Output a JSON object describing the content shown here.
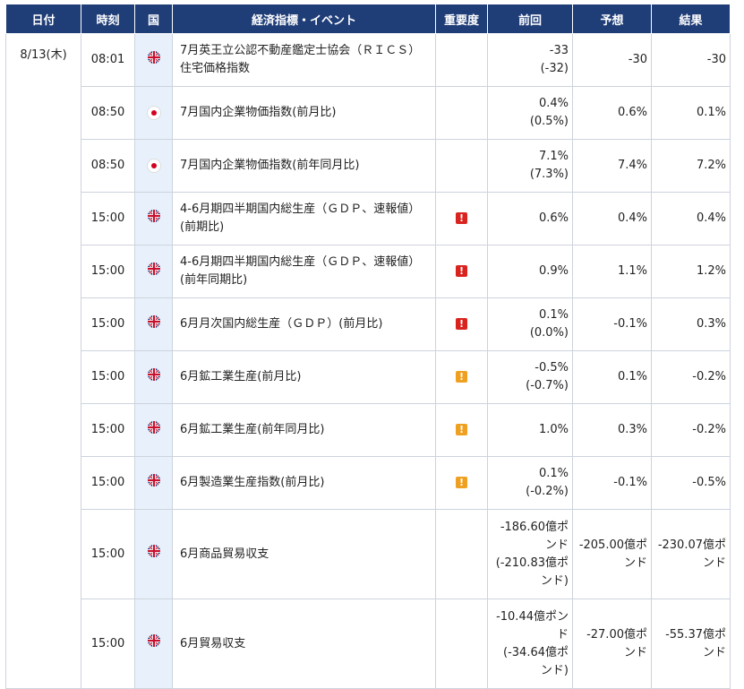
{
  "headers": {
    "date": "日付",
    "time": "時刻",
    "country": "国",
    "event": "経済指標・イベント",
    "importance": "重要度",
    "previous": "前回",
    "forecast": "予想",
    "result": "結果"
  },
  "date": "8/13(木)",
  "rows": [
    {
      "time": "08:01",
      "flag": "uk-flag-icon",
      "event": "7月英王立公認不動産鑑定士協会（ＲＩＣＳ）住宅価格指数",
      "importance": "",
      "previous": "-33",
      "previous_revised": "(-32)",
      "forecast": "-30",
      "result": "-30"
    },
    {
      "time": "08:50",
      "flag": "japan-flag-icon",
      "event": "7月国内企業物価指数(前月比)",
      "importance": "",
      "previous": "0.4%",
      "previous_revised": "(0.5%)",
      "forecast": "0.6%",
      "result": "0.1%"
    },
    {
      "time": "08:50",
      "flag": "japan-flag-icon",
      "event": "7月国内企業物価指数(前年同月比)",
      "importance": "",
      "previous": "7.1%",
      "previous_revised": "(7.3%)",
      "forecast": "7.4%",
      "result": "7.2%"
    },
    {
      "time": "15:00",
      "flag": "uk-flag-icon",
      "event": "4-6月期四半期国内総生産（ＧＤＰ、速報値）(前期比)",
      "importance": "high",
      "previous": "0.6%",
      "previous_revised": "",
      "forecast": "0.4%",
      "result": "0.4%"
    },
    {
      "time": "15:00",
      "flag": "uk-flag-icon",
      "event": "4-6月期四半期国内総生産（ＧＤＰ、速報値）(前年同期比)",
      "importance": "high",
      "previous": "0.9%",
      "previous_revised": "",
      "forecast": "1.1%",
      "result": "1.2%"
    },
    {
      "time": "15:00",
      "flag": "uk-flag-icon",
      "event": "6月月次国内総生産（ＧＤＰ）(前月比)",
      "importance": "high",
      "previous": "0.1%",
      "previous_revised": "(0.0%)",
      "forecast": "-0.1%",
      "result": "0.3%"
    },
    {
      "time": "15:00",
      "flag": "uk-flag-icon",
      "event": "6月鉱工業生産(前月比)",
      "importance": "medium",
      "previous": "-0.5%",
      "previous_revised": "(-0.7%)",
      "forecast": "0.1%",
      "result": "-0.2%"
    },
    {
      "time": "15:00",
      "flag": "uk-flag-icon",
      "event": "6月鉱工業生産(前年同月比)",
      "importance": "medium",
      "previous": "1.0%",
      "previous_revised": "",
      "forecast": "0.3%",
      "result": "-0.2%"
    },
    {
      "time": "15:00",
      "flag": "uk-flag-icon",
      "event": "6月製造業生産指数(前月比)",
      "importance": "medium",
      "previous": "0.1%",
      "previous_revised": "(-0.2%)",
      "forecast": "-0.1%",
      "result": "-0.5%"
    },
    {
      "time": "15:00",
      "flag": "uk-flag-icon",
      "event": "6月商品貿易収支",
      "importance": "",
      "previous": "-186.60億ポンド",
      "previous_revised": "(-210.83億ポンド)",
      "forecast": "-205.00億ポンド",
      "result": "-230.07億ポンド"
    },
    {
      "time": "15:00",
      "flag": "uk-flag-icon",
      "event": "6月貿易収支",
      "importance": "",
      "previous": "-10.44億ポンド",
      "previous_revised": "(-34.64億ポンド)",
      "forecast": "-27.00億ポンド",
      "result": "-55.37億ポンド"
    }
  ],
  "importance_marks": {
    "high": "!",
    "medium": "!"
  },
  "colors": {
    "header_bg": "#1f3d77",
    "flag_col_bg": "#e8f1fb",
    "high": "#d9231f",
    "medium": "#f0a020"
  }
}
